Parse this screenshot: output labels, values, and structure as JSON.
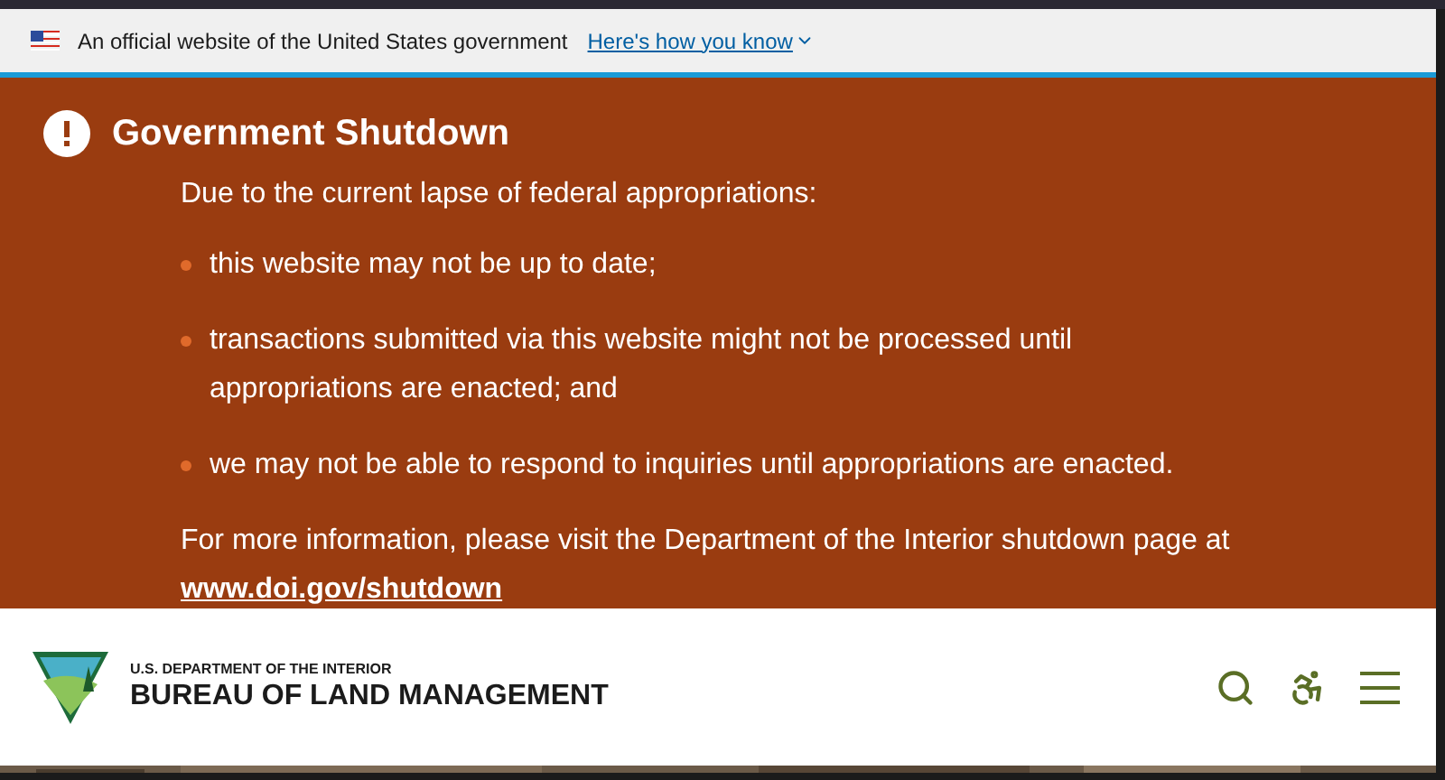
{
  "gov_banner": {
    "text": "An official website of the United States government",
    "link": "Here's how you know"
  },
  "alert": {
    "title": "Government Shutdown",
    "intro": "Due to the current lapse of federal appropriations:",
    "items": [
      "this website may not be up to date;",
      "transactions submitted via this website might not be processed until appropriations are enacted; and",
      "we may not be able to respond to inquiries until appropriations are enacted."
    ],
    "more": "For more information, please visit the Department of the Interior shutdown page at",
    "link": "www.doi.gov/shutdown"
  },
  "header": {
    "department": "U.S. DEPARTMENT OF THE INTERIOR",
    "agency": "BUREAU OF LAND MANAGEMENT"
  }
}
